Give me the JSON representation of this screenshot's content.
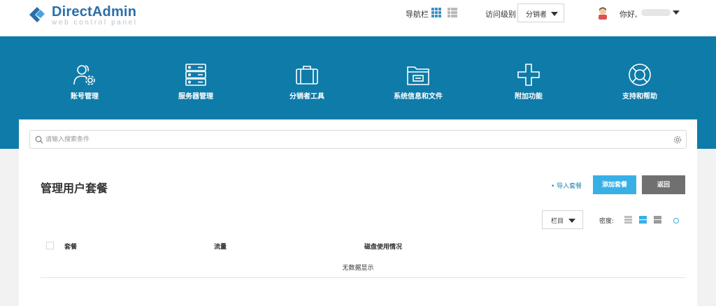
{
  "brand": {
    "name": "DirectAdmin",
    "tagline": "web control panel"
  },
  "header": {
    "nav_label": "导航栏",
    "access_level_label": "访问级别",
    "access_level_value": "分销者",
    "greeting": "你好,"
  },
  "menu": [
    {
      "label": "账号管理",
      "icon": "user-gear-icon"
    },
    {
      "label": "服务器管理",
      "icon": "server-icon"
    },
    {
      "label": "分销者工具",
      "icon": "briefcase-icon"
    },
    {
      "label": "系统信息和文件",
      "icon": "folder-icon"
    },
    {
      "label": "附加功能",
      "icon": "plus-icon"
    },
    {
      "label": "支持和帮助",
      "icon": "lifebuoy-icon"
    }
  ],
  "search": {
    "placeholder": "请输入搜索条件"
  },
  "page": {
    "title": "管理用户套餐",
    "import_label": "• 导入套餐",
    "add_label": "添加套餐",
    "back_label": "返回"
  },
  "table_controls": {
    "columns_label": "栏目",
    "density_label": "密度:"
  },
  "table": {
    "headers": [
      "套餐",
      "流量",
      "磁盘使用情况"
    ],
    "empty_message": "无数据显示"
  },
  "colors": {
    "band": "#0f7ba8",
    "accent": "#39b0e5",
    "back_button": "#707070",
    "brand": "#2a6fa8"
  }
}
